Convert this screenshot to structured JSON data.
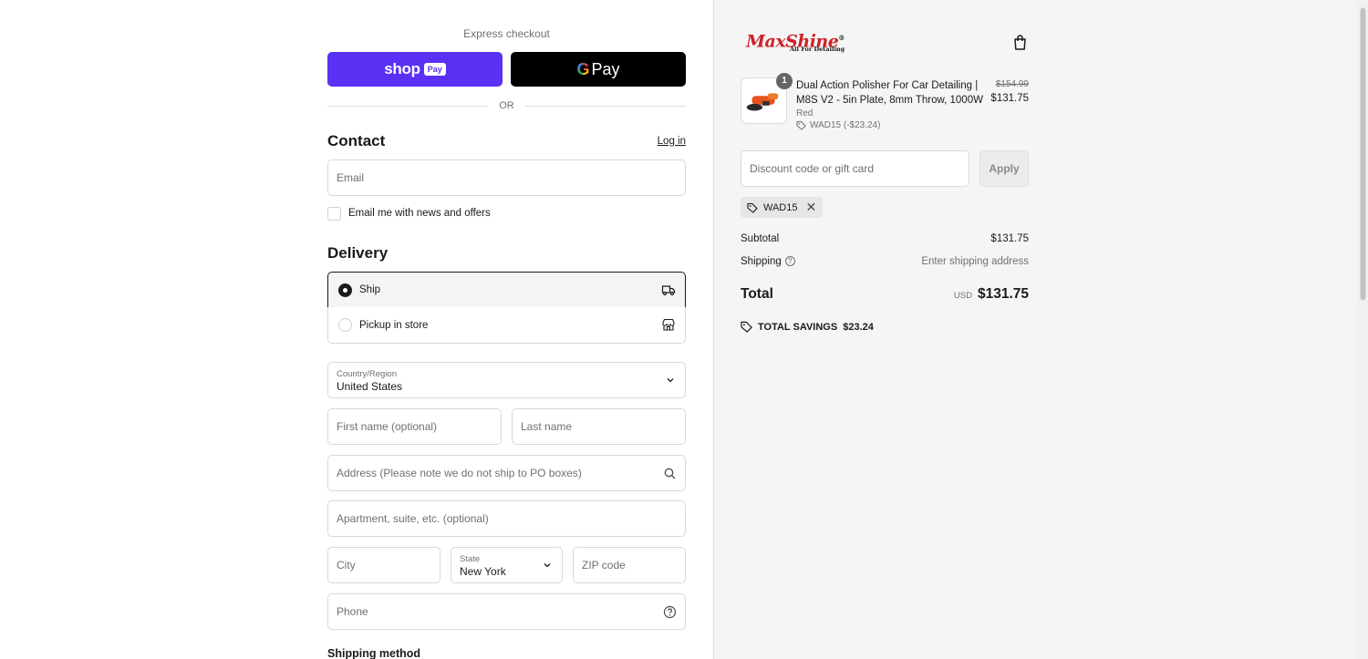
{
  "express": {
    "title": "Express checkout",
    "shop_pay": {
      "word": "shop",
      "badge": "Pay"
    },
    "gpay": {
      "g": "G",
      "pay": "Pay"
    },
    "or": "OR"
  },
  "contact": {
    "heading": "Contact",
    "login": "Log in",
    "email_placeholder": "Email",
    "news_label": "Email me with news and offers"
  },
  "delivery": {
    "heading": "Delivery",
    "options": [
      {
        "label": "Ship",
        "selected": true
      },
      {
        "label": "Pickup in store",
        "selected": false
      }
    ],
    "country": {
      "label": "Country/Region",
      "value": "United States"
    },
    "first_name": "First name (optional)",
    "last_name": "Last name",
    "address": "Address (Please note we do not ship to PO boxes)",
    "apartment": "Apartment, suite, etc. (optional)",
    "city": "City",
    "state": {
      "label": "State",
      "value": "New York"
    },
    "zip": "ZIP code",
    "phone": "Phone"
  },
  "shipping_method": "Shipping method",
  "brand": {
    "name": "MaxShine",
    "registered": "®",
    "tagline": "All For Detailing",
    "color": "#d0202a"
  },
  "cart": {
    "items": [
      {
        "quantity": "1",
        "name": "Dual Action Polisher For Car Detailing | M8S V2 - 5in Plate, 8mm Throw, 1000W",
        "variant": "Red",
        "discount": "WAD15 (-$23.24)",
        "original_price": "$154.99",
        "price": "$131.75"
      }
    ],
    "discount_placeholder": "Discount code or gift card",
    "apply_label": "Apply",
    "applied_code": "WAD15",
    "subtotal_label": "Subtotal",
    "subtotal": "$131.75",
    "shipping_label": "Shipping",
    "shipping_value": "Enter shipping address",
    "total_label": "Total",
    "currency": "USD",
    "total": "$131.75",
    "savings_label": "TOTAL SAVINGS",
    "savings": "$23.24"
  },
  "colors": {
    "shop_pay": "#5a31f4",
    "gpay": "#000000",
    "sidebar_bg": "#f5f5f5"
  }
}
